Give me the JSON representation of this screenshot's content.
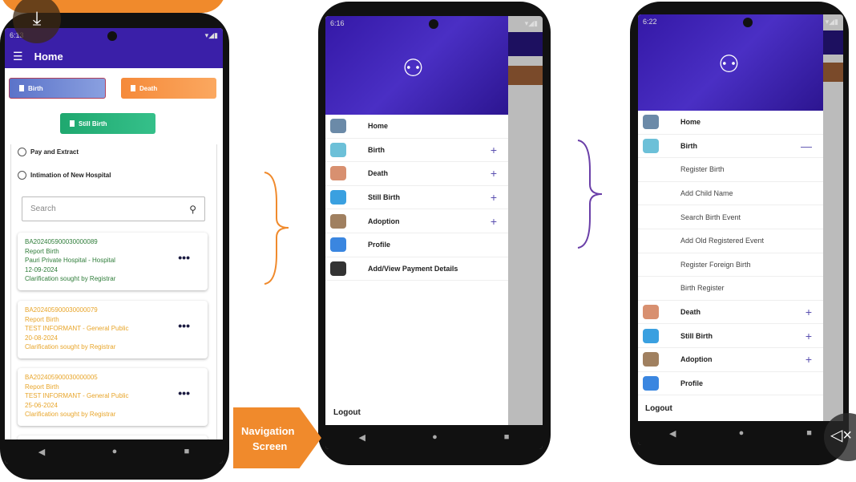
{
  "colors": {
    "primary": "#3a1fa8",
    "birth": "#5b73c9",
    "death": "#f58a3a",
    "still_birth": "#1fa86f",
    "accent_orange": "#f08a2c",
    "purple_brace": "#6a3fa8"
  },
  "home_screen": {
    "status_time": "6:13",
    "title": "Home",
    "buttons": {
      "birth": "Birth",
      "death": "Death",
      "still_birth": "Still Birth"
    },
    "options": [
      "Pay and Extract",
      "Intimation of New Hospital"
    ],
    "search_placeholder": "Search",
    "cards": [
      {
        "id": "BA202405900030000089",
        "type": "Report Birth",
        "place": "Pauri Private Hospital - Hospital",
        "date": "12-09-2024",
        "status": "Clarification sought by Registrar",
        "color": "#2f7d3a"
      },
      {
        "id": "BA202405900030000079",
        "type": "Report Birth",
        "place": "TEST INFORMANT - General Public",
        "date": "20-08-2024",
        "status": "Clarification sought by Registrar",
        "color": "#e8a52a"
      },
      {
        "id": "BA202405900030000005",
        "type": "Report Birth",
        "place": "TEST INFORMANT - General Public",
        "date": "25-06-2024",
        "status": "Clarification sought by Registrar",
        "color": "#e8a52a"
      }
    ]
  },
  "drawer_screen": {
    "status_time": "6:16",
    "items": [
      {
        "label": "Home",
        "icon": "home-monitor-icon",
        "expand": ""
      },
      {
        "label": "Birth",
        "icon": "baby-icon",
        "expand": "+"
      },
      {
        "label": "Death",
        "icon": "feet-icon",
        "expand": "+"
      },
      {
        "label": "Still Birth",
        "icon": "still-birth-icon",
        "expand": "+"
      },
      {
        "label": "Adoption",
        "icon": "adoption-icon",
        "expand": "+"
      },
      {
        "label": "Profile",
        "icon": "profile-icon",
        "expand": ""
      },
      {
        "label": "Add/View Payment Details",
        "icon": "payment-icon",
        "expand": ""
      }
    ],
    "logout": "Logout"
  },
  "expanded_screen": {
    "status_time": "6:22",
    "items": [
      {
        "label": "Home",
        "expand": ""
      },
      {
        "label": "Birth",
        "expand": "—"
      },
      {
        "label": "Register Birth",
        "sub": true
      },
      {
        "label": "Add Child Name",
        "sub": true
      },
      {
        "label": "Search Birth Event",
        "sub": true
      },
      {
        "label": "Add Old Registered Event",
        "sub": true
      },
      {
        "label": "Register Foreign Birth",
        "sub": true
      },
      {
        "label": "Birth Register",
        "sub": true
      },
      {
        "label": "Death",
        "expand": "+"
      },
      {
        "label": "Still Birth",
        "expand": "+"
      },
      {
        "label": "Adoption",
        "expand": "+"
      },
      {
        "label": "Profile",
        "expand": ""
      }
    ],
    "logout": "Logout"
  },
  "callout": {
    "line1": "Navigation",
    "line2": "Screen"
  }
}
